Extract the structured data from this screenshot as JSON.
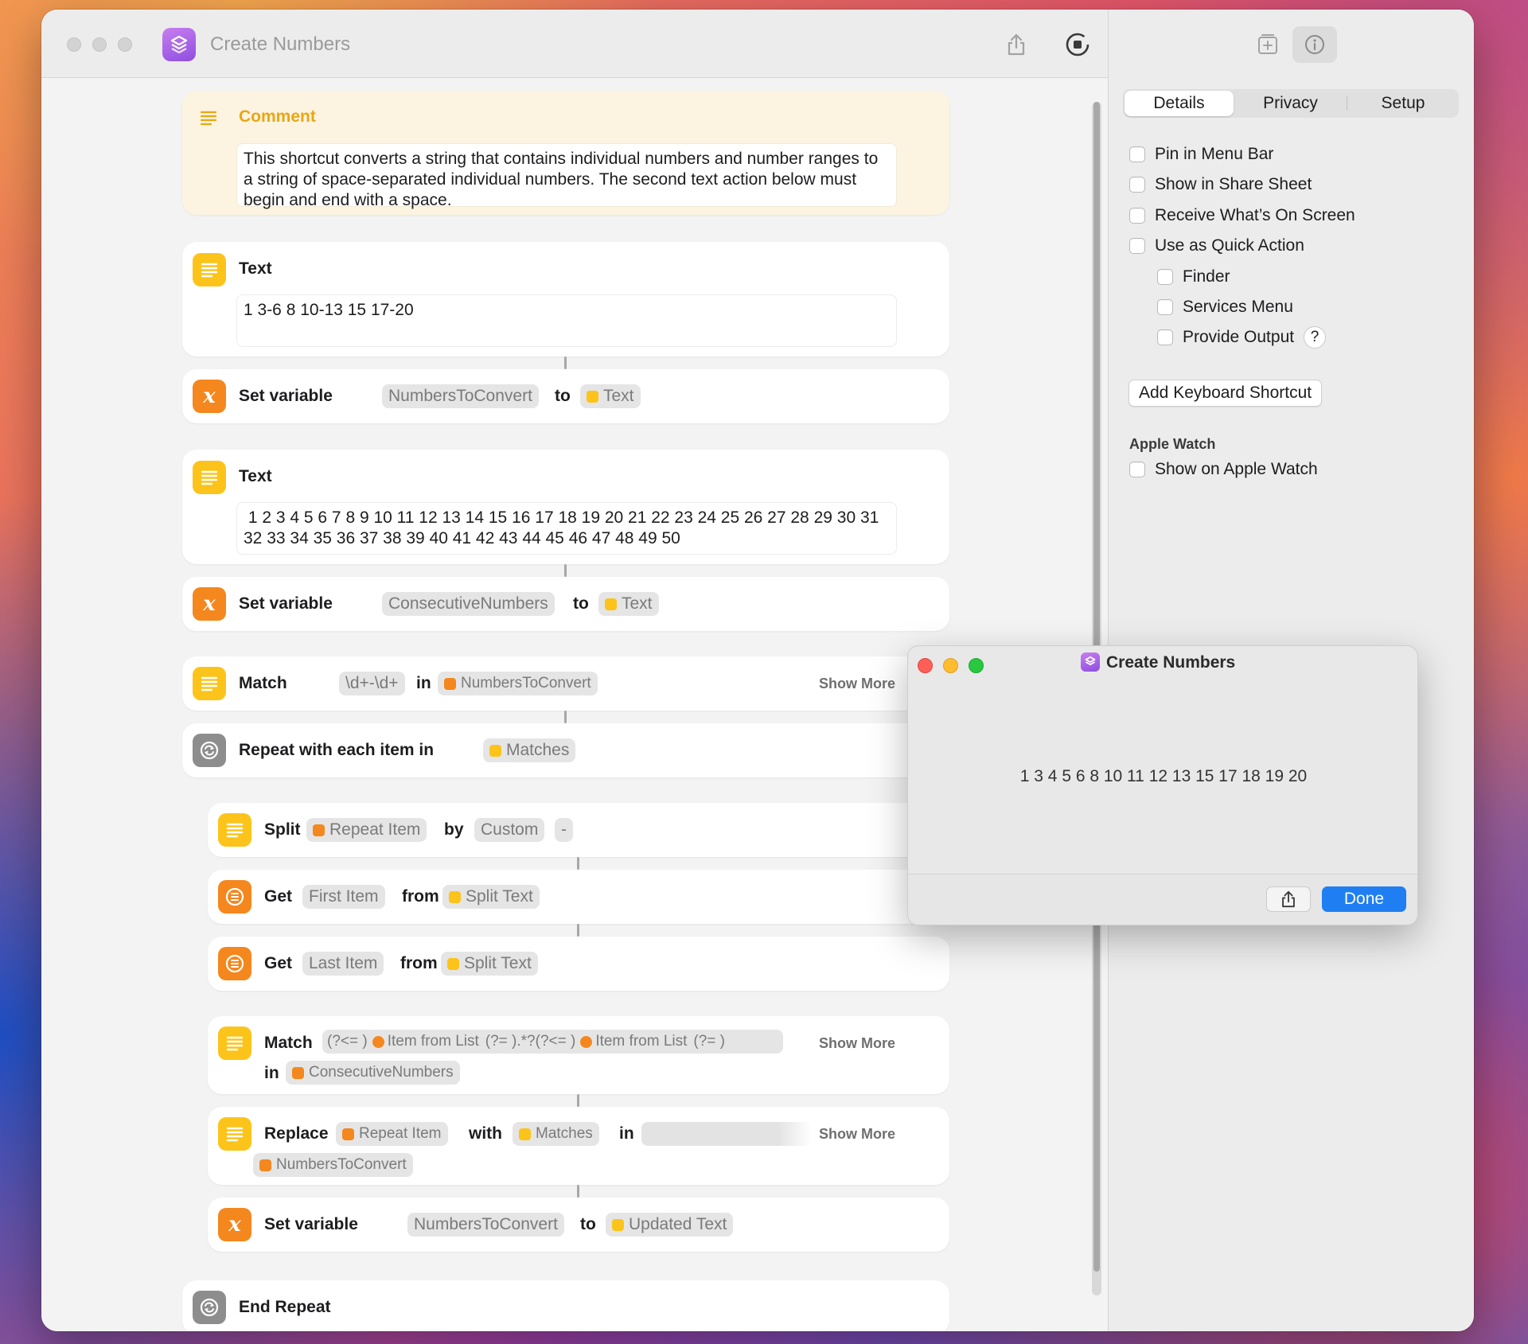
{
  "window": {
    "title": "Create Numbers"
  },
  "comment": {
    "label": "Comment",
    "text": "This shortcut converts a string that contains individual numbers and number ranges to a string of space-separated individual numbers. The second text action below must begin and end with a space."
  },
  "actions": {
    "text1": {
      "label": "Text",
      "value": "1 3-6 8 10-13 15 17-20"
    },
    "setvar1": {
      "label": "Set variable",
      "variable": "NumbersToConvert",
      "to": "to",
      "value": "Text"
    },
    "text2": {
      "label": "Text",
      "value": " 1 2 3 4 5 6 7 8 9 10 11 12 13 14 15 16 17 18 19 20 21 22 23 24 25 26 27 28 29 30 31 32 33 34 35 36 37 38 39 40 41 42 43 44 45 46 47 48 49 50"
    },
    "setvar2": {
      "label": "Set variable",
      "variable": "ConsecutiveNumbers",
      "to": "to",
      "value": "Text"
    },
    "match1": {
      "label": "Match",
      "pattern": "\\d+-\\d+",
      "in": "in",
      "source": "NumbersToConvert",
      "show_more": "Show More"
    },
    "repeat": {
      "label": "Repeat with each item in",
      "source": "Matches"
    },
    "split": {
      "label": "Split",
      "source": "Repeat Item",
      "by": "by",
      "separator_type": "Custom",
      "separator": "-"
    },
    "get_first": {
      "label": "Get",
      "item": "First Item",
      "from": "from",
      "source": "Split Text"
    },
    "get_last": {
      "label": "Get",
      "item": "Last Item",
      "from": "from",
      "source": "Split Text"
    },
    "match2": {
      "label": "Match",
      "p1": "(?<= )",
      "p2": "Item from List",
      "p3": "(?= ).*?(?<= )",
      "p4": "Item from List",
      "p5": "(?= )",
      "in": "in",
      "source": "ConsecutiveNumbers",
      "show_more": "Show More"
    },
    "replace": {
      "label": "Replace",
      "target": "Repeat Item",
      "with": "with",
      "replacement": "Matches",
      "in": "in",
      "source": "NumbersToConvert",
      "show_more": "Show More"
    },
    "setvar3": {
      "label": "Set variable",
      "variable": "NumbersToConvert",
      "to": "to",
      "value": "Updated Text"
    },
    "end_repeat": {
      "label": "End Repeat"
    }
  },
  "sidebar": {
    "tabs": [
      "Details",
      "Privacy",
      "Setup"
    ],
    "options": {
      "pin_menu_bar": "Pin in Menu Bar",
      "share_sheet": "Show in Share Sheet",
      "receive_screen": "Receive What’s On Screen",
      "quick_action": "Use as Quick Action",
      "finder": "Finder",
      "services_menu": "Services Menu",
      "provide_output": "Provide Output"
    },
    "help": "?",
    "keyboard_button": "Add Keyboard Shortcut",
    "watch_header": "Apple Watch",
    "watch_option": "Show on Apple Watch"
  },
  "dialog": {
    "title": "Create Numbers",
    "result": "1 3 4 5 6 8 10 11 12 13 15 17 18 19 20",
    "done": "Done"
  },
  "colors": {
    "accent": "#1f7ff2",
    "text_action": "#fcc41a",
    "variable_action": "#f4871d",
    "comment_label": "#e9a713",
    "close": "#ff5f57",
    "minimize": "#febc2e",
    "zoom": "#28c840"
  },
  "icons": {
    "app": "shortcuts-icon",
    "share": "share-icon",
    "run": "run-stop-icon",
    "add_action": "add-action-icon",
    "info": "info-icon",
    "text": "text-lines-icon",
    "variable": "variable-x-icon",
    "repeat": "repeat-icon",
    "list": "list-icon"
  }
}
